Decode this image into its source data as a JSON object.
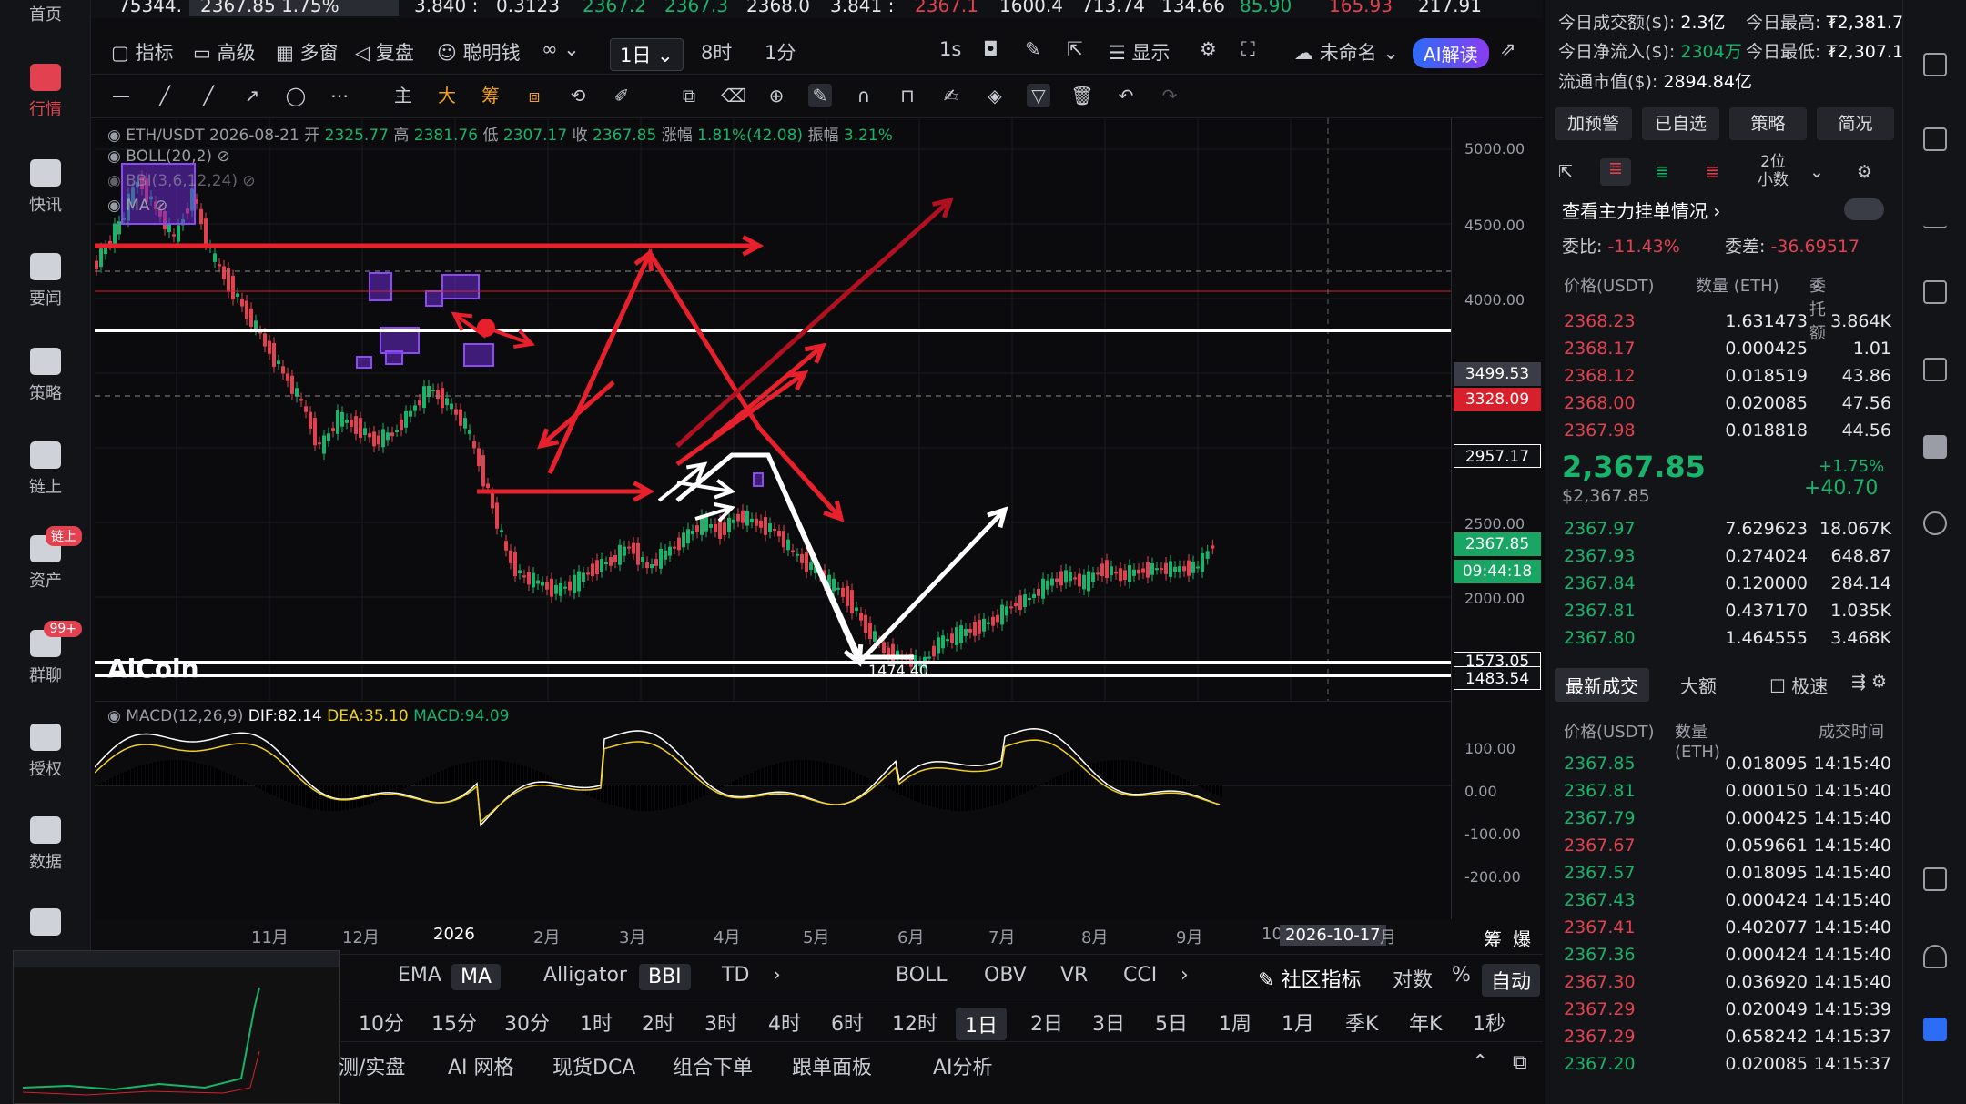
{
  "sidebar": {
    "top_label": "首页",
    "items": [
      {
        "label": "行情",
        "icon": "bar-chart-icon",
        "active": true
      },
      {
        "label": "快讯",
        "icon": "news-icon"
      },
      {
        "label": "要闻",
        "icon": "document-icon"
      },
      {
        "label": "策略",
        "icon": "robot-icon"
      },
      {
        "label": "链上",
        "icon": "chain-icon"
      },
      {
        "label": "资产",
        "icon": "wallet-icon",
        "badge": "链上"
      },
      {
        "label": "群聊",
        "icon": "chat-icon",
        "badge": "99+"
      },
      {
        "label": "授权",
        "icon": "key-icon"
      },
      {
        "label": "数据",
        "icon": "data-icon"
      },
      {
        "label": "",
        "icon": "apps-icon"
      }
    ]
  },
  "ticker_strip": {
    "items": [
      "75344.",
      "2367.85 1.75%",
      "3.840 :",
      "0.3123",
      "2367.2",
      "2367.3",
      "2368.0",
      "3.841 :",
      "2367.1",
      "1600.4",
      "713.74",
      "134.66",
      "85.90",
      "165.93",
      "217.91"
    ]
  },
  "toolbar": {
    "indicators": "指标",
    "advanced": "高级",
    "multi_window": "多窗",
    "replay": "复盘",
    "smart_money": "聪明钱",
    "period": "1日",
    "p8h": "8时",
    "p1m": "1分",
    "p1s": "1s",
    "display": "显示",
    "unnamed": "未命名",
    "ai": "AI解读"
  },
  "drawing_tools": {
    "main": "主",
    "big": "大",
    "chip": "筹"
  },
  "chart": {
    "symbol": "ETH/USDT",
    "date": "2026-08-21",
    "open_label": "开",
    "open": "2325.77",
    "high_label": "高",
    "high": "2381.76",
    "low_label": "低",
    "low": "2307.17",
    "close_label": "收",
    "close": "2367.85",
    "change_label": "涨幅",
    "change": "1.81%(42.08)",
    "amp_label": "振幅",
    "amplitude": "3.21%",
    "indicator_boll": "BOLL(20,2)",
    "indicator_bbi": "BBI(3,6,12,24)",
    "indicator_ma": "MA",
    "y_ticks": [
      "5000.00",
      "4500.00",
      "4000.00",
      "3499.53",
      "2500.00",
      "2000.00"
    ],
    "price_tags": {
      "crosshair": "3499.53",
      "red_line": "3328.09",
      "support1": "2957.17",
      "last": "2367.85",
      "countdown": "09:44:18",
      "support2": "1573.05",
      "support3": "1483.54"
    },
    "low_marker": "1474.40",
    "watermark": "AiCoin",
    "colors": {
      "up": "#19b36b",
      "down": "#e2424f",
      "drawing_red": "#e8202c",
      "drawing_white": "#ffffff",
      "box_purple": "#6a2bd1"
    }
  },
  "macd": {
    "label": "MACD(12,26,9)",
    "dif": "DIF:82.14",
    "dea": "DEA:35.10",
    "macd": "MACD:94.09",
    "y_ticks": [
      "100.00",
      "0.00",
      "-100.00",
      "-200.00"
    ]
  },
  "x_axis": {
    "labels": [
      "11月",
      "12月",
      "2026",
      "2月",
      "3月",
      "4月",
      "5月",
      "6月",
      "7月",
      "8月",
      "9月",
      "10",
      "月"
    ],
    "cursor_date": "2026-10-17",
    "right_labels": [
      "筹",
      "爆"
    ]
  },
  "indicator_tabs": [
    "EMA",
    "MA",
    "Alligator",
    "BBI",
    "TD",
    "BOLL",
    "OBV",
    "VR",
    "CCI"
  ],
  "indicator_right": {
    "community": "社区指标",
    "log": "对数",
    "percent": "%",
    "auto": "自动"
  },
  "timeframes": [
    "10分",
    "15分",
    "30分",
    "1时",
    "2时",
    "3时",
    "4时",
    "6时",
    "12时",
    "1日",
    "2日",
    "3日",
    "5日",
    "1周",
    "1月",
    "季K",
    "年K",
    "1秒"
  ],
  "timeframe_selected": "1日",
  "bottom_tools": [
    "测/实盘",
    "AI 网格",
    "现货DCA",
    "组合下单",
    "跟单面板",
    "AI分析"
  ],
  "right_panel": {
    "stats": {
      "volume_label": "今日成交额($):",
      "volume": "2.3亿",
      "high_label": "今日最高:",
      "high": "₮2,381.76",
      "netflow_label": "今日净流入($):",
      "netflow": "2304万",
      "low_label": "今日最低:",
      "low": "₮2,307.17",
      "mcap_label": "流通市值($):",
      "mcap": "2894.84亿"
    },
    "buttons": [
      "加预警",
      "已自选",
      "策略",
      "简况"
    ],
    "decimals": "2位小数",
    "main_orders": "查看主力挂单情况",
    "ratio_label": "委比:",
    "ratio": "-11.43%",
    "diff_label": "委差:",
    "diff": "-36.69517",
    "ob_headers": [
      "价格(USDT)",
      "数量 (ETH)",
      "委托额"
    ],
    "asks": [
      [
        "2368.23",
        "1.631473",
        "3.864K"
      ],
      [
        "2368.17",
        "0.000425",
        "1.01"
      ],
      [
        "2368.12",
        "0.018519",
        "43.86"
      ],
      [
        "2368.00",
        "0.020085",
        "47.56"
      ],
      [
        "2367.98",
        "0.018818",
        "44.56"
      ]
    ],
    "last_price": "2,367.85",
    "last_usd": "$2,367.85",
    "last_pct": "+1.75%",
    "last_change": "+40.70",
    "bids": [
      [
        "2367.97",
        "7.629623",
        "18.067K"
      ],
      [
        "2367.93",
        "0.274024",
        "648.87"
      ],
      [
        "2367.84",
        "0.120000",
        "284.14"
      ],
      [
        "2367.81",
        "0.437170",
        "1.035K"
      ],
      [
        "2367.80",
        "1.464555",
        "3.468K"
      ]
    ],
    "trades_tabs": [
      "最新成交",
      "大额",
      "极速"
    ],
    "trade_headers": [
      "价格(USDT)",
      "数量(ETH)",
      "成交时间"
    ],
    "trades": [
      [
        "2367.85",
        "0.018095",
        "14:15:40",
        "up"
      ],
      [
        "2367.81",
        "0.000150",
        "14:15:40",
        "up"
      ],
      [
        "2367.79",
        "0.000425",
        "14:15:40",
        "up"
      ],
      [
        "2367.67",
        "0.059661",
        "14:15:40",
        "down"
      ],
      [
        "2367.57",
        "0.018095",
        "14:15:40",
        "up"
      ],
      [
        "2367.43",
        "0.000424",
        "14:15:40",
        "up"
      ],
      [
        "2367.41",
        "0.402077",
        "14:15:40",
        "down"
      ],
      [
        "2367.36",
        "0.000424",
        "14:15:40",
        "up"
      ],
      [
        "2367.30",
        "0.036920",
        "14:15:40",
        "down"
      ],
      [
        "2367.29",
        "0.020049",
        "14:15:39",
        "down"
      ],
      [
        "2367.29",
        "0.658242",
        "14:15:37",
        "down"
      ],
      [
        "2367.20",
        "0.020085",
        "14:15:37",
        "up"
      ]
    ]
  }
}
